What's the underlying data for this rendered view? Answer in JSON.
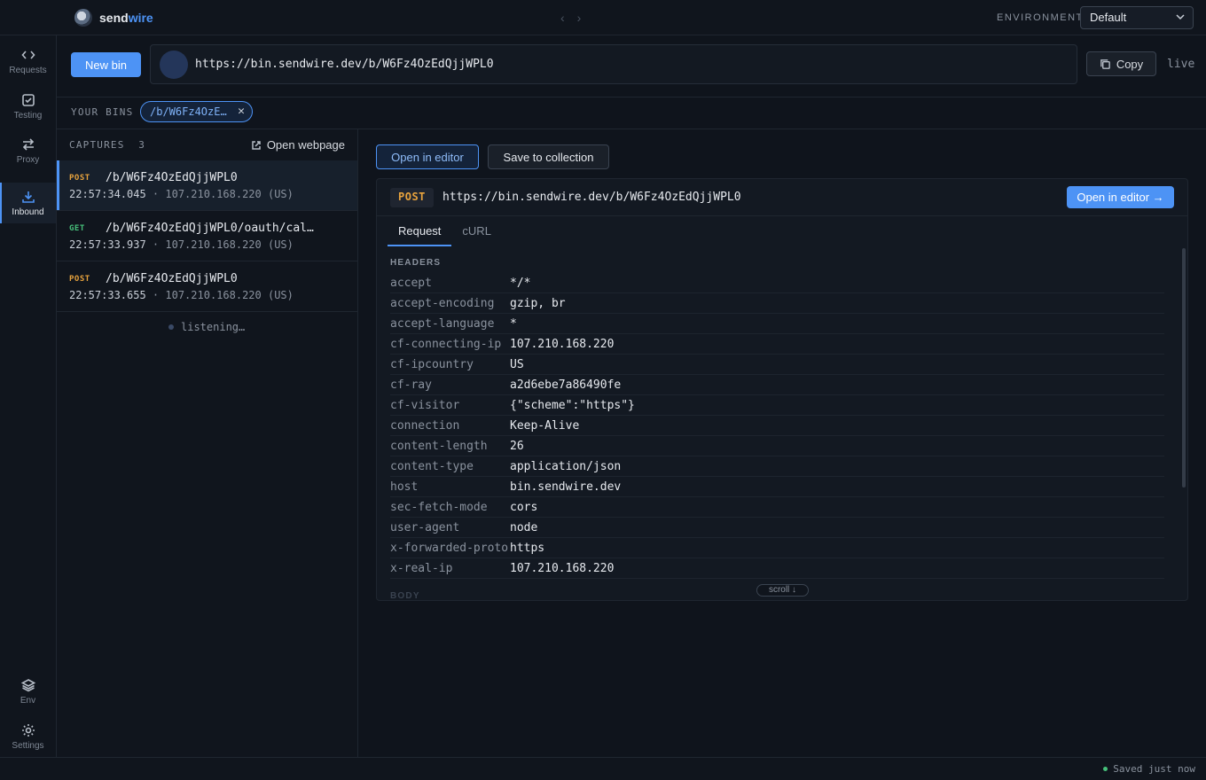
{
  "app": {
    "logo_part1": "send",
    "logo_part2": "wire"
  },
  "nav": {
    "back": "‹",
    "forward": "›"
  },
  "environment": {
    "label": "ENVIRONMENT",
    "selected": "Default"
  },
  "sidebar": {
    "items": [
      {
        "label": "Requests",
        "icon": "code-icon"
      },
      {
        "label": "Testing",
        "icon": "check-square-icon"
      },
      {
        "label": "Proxy",
        "icon": "arrows-swap-icon"
      },
      {
        "label": "Inbound",
        "icon": "download-icon"
      }
    ],
    "bottom": [
      {
        "label": "Env",
        "icon": "layers-icon"
      },
      {
        "label": "Settings",
        "icon": "gear-icon"
      }
    ]
  },
  "urlbar": {
    "new_bin": "New bin",
    "url": "https://bin.sendwire.dev/b/W6Fz4OzEdQjjWPL0",
    "copy": "Copy",
    "status": "live"
  },
  "bins": {
    "label": "YOUR BINS",
    "chip": "/b/W6Fz4OzE…",
    "close": "✕"
  },
  "captures": {
    "title": "CAPTURES",
    "count": "3",
    "open_webpage": "Open webpage",
    "items": [
      {
        "method": "POST",
        "path": "/b/W6Fz4OzEdQjjWPL0",
        "time": "22:57:34.045",
        "meta": " · 107.210.168.220 (US)"
      },
      {
        "method": "GET",
        "path": "/b/W6Fz4OzEdQjjWPL0/oauth/cal…",
        "time": "22:57:33.937",
        "meta": " · 107.210.168.220 (US)"
      },
      {
        "method": "POST",
        "path": "/b/W6Fz4OzEdQjjWPL0",
        "time": "22:57:33.655",
        "meta": " · 107.210.168.220 (US)"
      }
    ],
    "listening": "listening…"
  },
  "detail": {
    "open_in_editor": "Open in editor",
    "save_to_collection": "Save to collection",
    "method": "POST",
    "url": "https://bin.sendwire.dev/b/W6Fz4OzEdQjjWPL0",
    "open_in_editor_arrow": "Open in editor →",
    "tabs": [
      "Request",
      "cURL"
    ],
    "headers_title": "HEADERS",
    "headers": [
      {
        "key": "accept",
        "value": "*/*"
      },
      {
        "key": "accept-encoding",
        "value": "gzip, br"
      },
      {
        "key": "accept-language",
        "value": "*"
      },
      {
        "key": "cf-connecting-ip",
        "value": "107.210.168.220"
      },
      {
        "key": "cf-ipcountry",
        "value": "US"
      },
      {
        "key": "cf-ray",
        "value": "a2d6ebe7a86490fe"
      },
      {
        "key": "cf-visitor",
        "value": "{\"scheme\":\"https\"}"
      },
      {
        "key": "connection",
        "value": "Keep-Alive"
      },
      {
        "key": "content-length",
        "value": "26"
      },
      {
        "key": "content-type",
        "value": "application/json"
      },
      {
        "key": "host",
        "value": "bin.sendwire.dev"
      },
      {
        "key": "sec-fetch-mode",
        "value": "cors"
      },
      {
        "key": "user-agent",
        "value": "node"
      },
      {
        "key": "x-forwarded-proto",
        "value": "https"
      },
      {
        "key": "x-real-ip",
        "value": "107.210.168.220"
      }
    ],
    "body_title": "BODY",
    "scroll_hint": "scroll ↓"
  },
  "status": {
    "saved": "Saved just now"
  },
  "colors": {
    "accent": "#4d93f5",
    "post": "#e8a33d",
    "get": "#46c07a"
  }
}
